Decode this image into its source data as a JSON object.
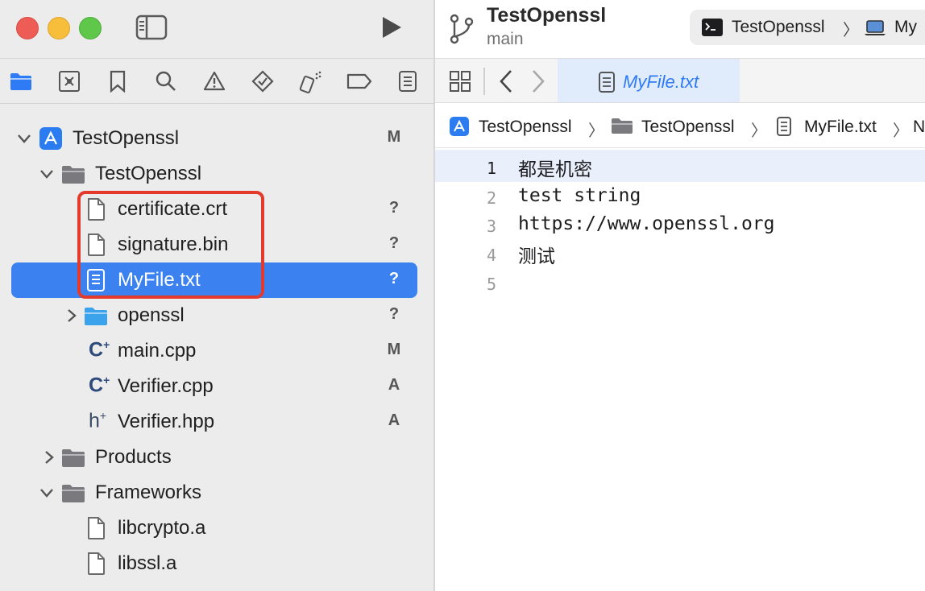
{
  "window": {
    "project_name": "TestOpenssl",
    "branch": "main"
  },
  "scheme": {
    "target": "TestOpenssl",
    "destination": "My"
  },
  "navigator_icons": [
    "folder-icon",
    "source-control-icon",
    "bookmark-icon",
    "search-icon",
    "warning-icon",
    "test-icon",
    "debug-icon",
    "breakpoint-icon",
    "report-icon"
  ],
  "tree": {
    "project": {
      "label": "TestOpenssl",
      "status": "M"
    },
    "group": {
      "label": "TestOpenssl"
    },
    "files": [
      {
        "label": "certificate.crt",
        "status": "?"
      },
      {
        "label": "signature.bin",
        "status": "?"
      },
      {
        "label": "MyFile.txt",
        "status": "?"
      },
      {
        "label": "openssl",
        "status": "?"
      },
      {
        "label": "main.cpp",
        "status": "M"
      },
      {
        "label": "Verifier.cpp",
        "status": "A"
      },
      {
        "label": "Verifier.hpp",
        "status": "A"
      }
    ],
    "products": {
      "label": "Products"
    },
    "frameworks": {
      "label": "Frameworks"
    },
    "framework_files": [
      {
        "label": "libcrypto.a"
      },
      {
        "label": "libssl.a"
      }
    ]
  },
  "tab": {
    "label": "MyFile.txt"
  },
  "jumpbar": [
    "TestOpenssl",
    "TestOpenssl",
    "MyFile.txt",
    "N"
  ],
  "editor": {
    "lines": [
      {
        "num": "1",
        "text": "都是机密"
      },
      {
        "num": "2",
        "text": "test string"
      },
      {
        "num": "3",
        "text": "https://www.openssl.org"
      },
      {
        "num": "4",
        "text": "测试"
      },
      {
        "num": "5",
        "text": ""
      }
    ]
  },
  "colors": {
    "selection": "#3b82f0",
    "highlight_border": "#e33a2c",
    "accent": "#2f7bf5"
  }
}
